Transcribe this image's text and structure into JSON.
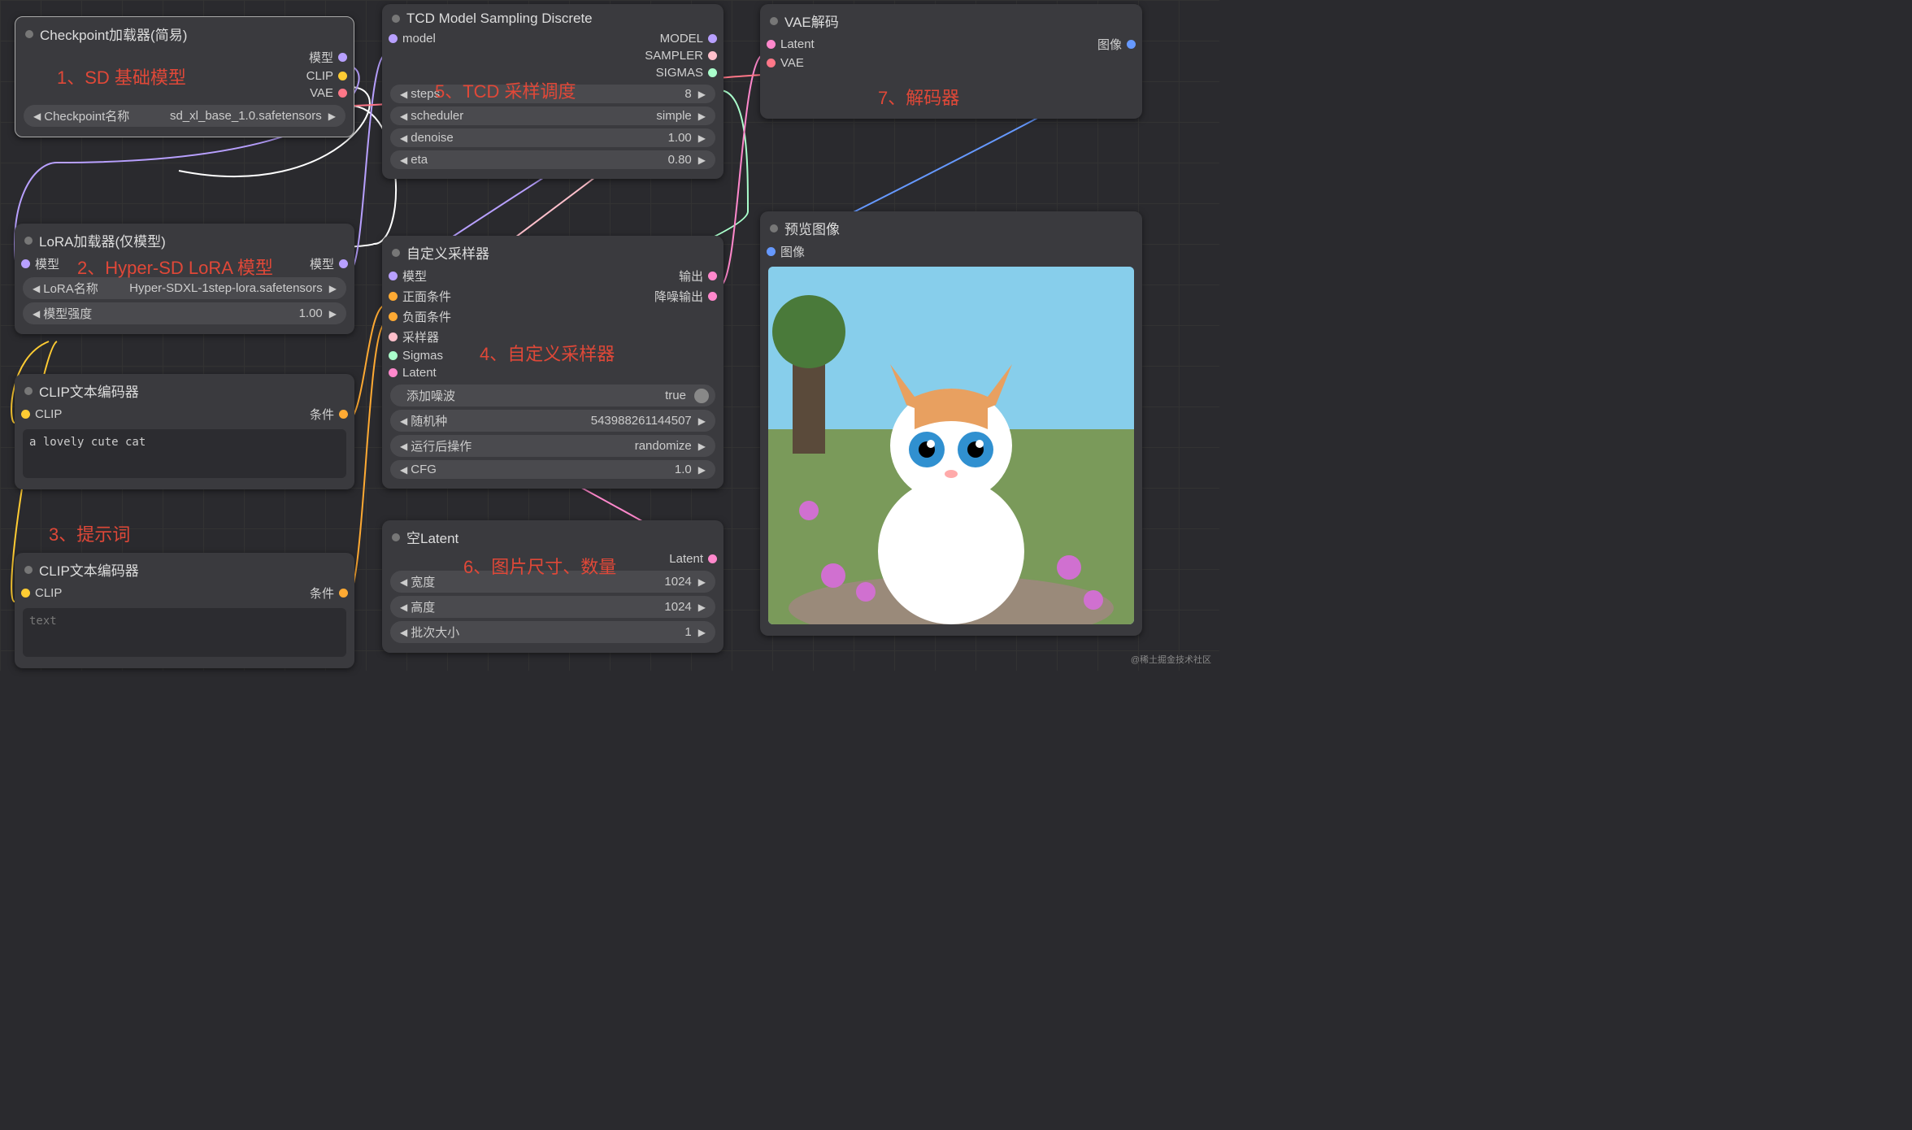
{
  "nodes": {
    "checkpoint": {
      "title": "Checkpoint加载器(简易)",
      "outputs": {
        "model": "模型",
        "clip": "CLIP",
        "vae": "VAE"
      },
      "param_label": "Checkpoint名称",
      "param_value": "sd_xl_base_1.0.safetensors"
    },
    "lora": {
      "title": "LoRA加载器(仅模型)",
      "inputs": {
        "model": "模型"
      },
      "outputs": {
        "model": "模型"
      },
      "name_label": "LoRA名称",
      "name_value": "Hyper-SDXL-1step-lora.safetensors",
      "strength_label": "模型强度",
      "strength_value": "1.00"
    },
    "clip_pos": {
      "title": "CLIP文本编码器",
      "inputs": {
        "clip": "CLIP"
      },
      "outputs": {
        "cond": "条件"
      },
      "text": "a lovely cute cat"
    },
    "clip_neg": {
      "title": "CLIP文本编码器",
      "inputs": {
        "clip": "CLIP"
      },
      "outputs": {
        "cond": "条件"
      },
      "text": "text"
    },
    "tcd": {
      "title": "TCD Model Sampling Discrete",
      "inputs": {
        "model": "model"
      },
      "outputs": {
        "model": "MODEL",
        "sampler": "SAMPLER",
        "sigmas": "SIGMAS"
      },
      "steps_label": "steps",
      "steps_value": "8",
      "scheduler_label": "scheduler",
      "scheduler_value": "simple",
      "denoise_label": "denoise",
      "denoise_value": "1.00",
      "eta_label": "eta",
      "eta_value": "0.80"
    },
    "sampler": {
      "title": "自定义采样器",
      "inputs": {
        "model": "模型",
        "pos": "正面条件",
        "neg": "负面条件",
        "sampler": "采样器",
        "sigmas": "Sigmas",
        "latent": "Latent"
      },
      "outputs": {
        "out": "输出",
        "denoised": "降噪输出"
      },
      "noise_label": "添加噪波",
      "noise_value": "true",
      "seed_label": "随机种",
      "seed_value": "543988261144507",
      "after_label": "运行后操作",
      "after_value": "randomize",
      "cfg_label": "CFG",
      "cfg_value": "1.0"
    },
    "latent": {
      "title": "空Latent",
      "outputs": {
        "latent": "Latent"
      },
      "width_label": "宽度",
      "width_value": "1024",
      "height_label": "高度",
      "height_value": "1024",
      "batch_label": "批次大小",
      "batch_value": "1"
    },
    "vae": {
      "title": "VAE解码",
      "inputs": {
        "latent": "Latent",
        "vae": "VAE"
      },
      "outputs": {
        "image": "图像"
      }
    },
    "preview": {
      "title": "预览图像",
      "inputs": {
        "image": "图像"
      }
    }
  },
  "annotations": {
    "a1": "1、SD 基础模型",
    "a2": "2、Hyper-SD LoRA 模型",
    "a3": "3、提示词",
    "a4": "4、自定义采样器",
    "a5": "5、TCD 采样调度",
    "a6": "6、图片尺寸、数量",
    "a7": "7、解码器"
  },
  "watermark": "@稀土掘金技术社区"
}
